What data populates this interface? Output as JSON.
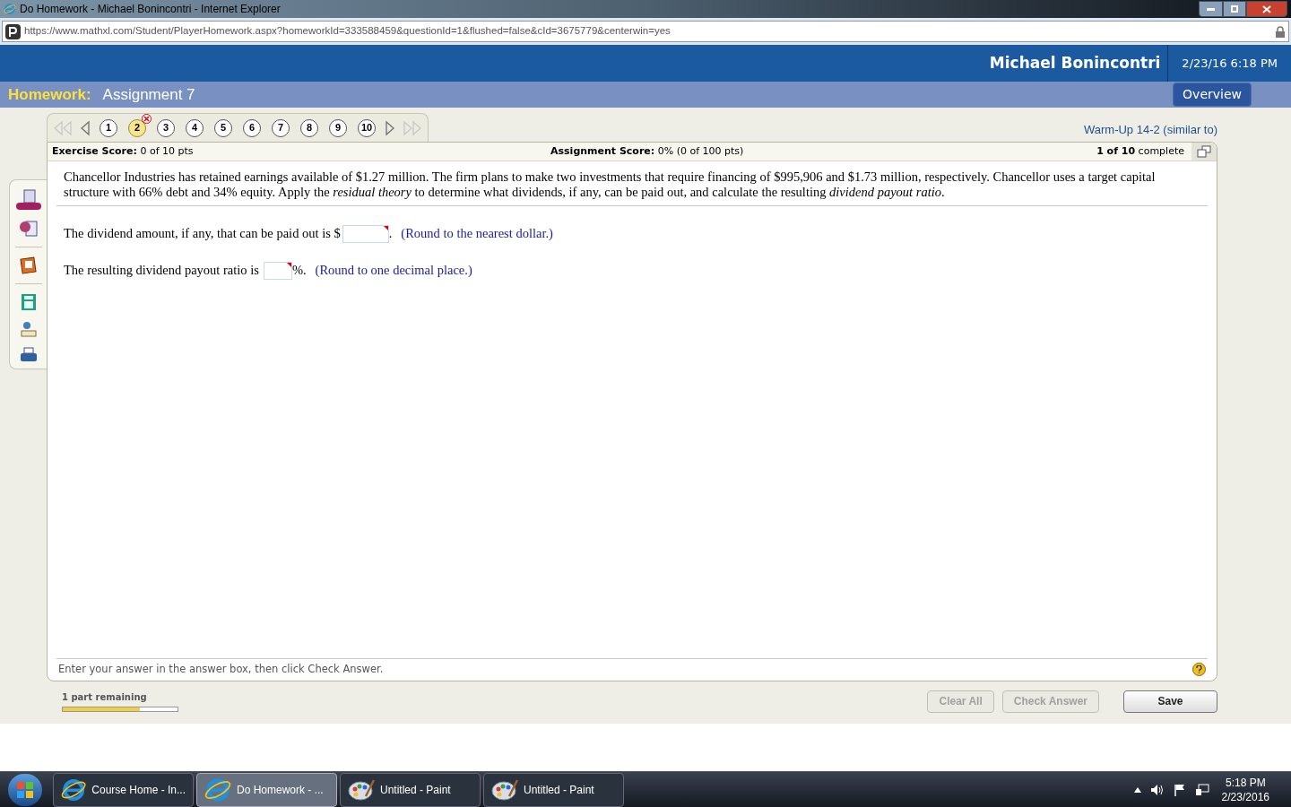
{
  "window": {
    "title": "Do Homework - Michael Bonincontri - Internet Explorer"
  },
  "address_bar": {
    "url": "https://www.mathxl.com/Student/PlayerHomework.aspx?homeworkId=333588459&questionId=1&flushed=false&cId=3675779&centerwin=yes"
  },
  "header": {
    "user": "Michael Bonincontri",
    "datetime": "2/23/16 6:18 PM"
  },
  "subheader": {
    "label": "Homework:",
    "assignment": "Assignment 7",
    "button": "Overview"
  },
  "question_nav": [
    {
      "label": "1",
      "selected": false,
      "incorrect": false
    },
    {
      "label": "2",
      "selected": true,
      "incorrect": true
    },
    {
      "label": "3",
      "selected": false,
      "incorrect": false
    },
    {
      "label": "4",
      "selected": false,
      "incorrect": false
    },
    {
      "label": "5",
      "selected": false,
      "incorrect": false
    },
    {
      "label": "6",
      "selected": false,
      "incorrect": false
    },
    {
      "label": "7",
      "selected": false,
      "incorrect": false
    },
    {
      "label": "8",
      "selected": false,
      "incorrect": false
    },
    {
      "label": "9",
      "selected": false,
      "incorrect": false
    },
    {
      "label": "10",
      "selected": false,
      "incorrect": false
    }
  ],
  "exercise_title": "Warm-Up 14-2 (similar to)",
  "scores": {
    "exercise_label": "Exercise Score:",
    "exercise_value": "0 of 10 pts",
    "assignment_label": "Assignment Score:",
    "assignment_value": "0% (0 of 100 pts)",
    "complete_count": "1 of 10",
    "complete_label": "complete"
  },
  "question": "Chancellor Industries has retained earnings available of $1.27 million.  The firm plans to make two investments that require financing of $995,906 and $1.73 million, respectively.  Chancellor uses a target capital structure with 66% debt and 34% equity.  Apply the *residual theory* to determine what dividends, if any, can be paid out, and calculate the resulting *dividend payout ratio*.",
  "answers": [
    {
      "before": "The dividend amount, if any, that can be paid out is $",
      "after": ".",
      "hint": "(Round to the nearest dollar.)",
      "wide": true
    },
    {
      "before": "The resulting dividend payout ratio is",
      "after": "%.",
      "hint": "(Round to one decimal place.)",
      "wide": false
    }
  ],
  "instruction": "Enter your answer in the answer box, then click Check Answer.",
  "progress": {
    "label": "1 part remaining",
    "level": 0.67
  },
  "buttons": [
    {
      "label": "Clear All",
      "disabled": true
    },
    {
      "label": "Check Answer",
      "disabled": true
    },
    {
      "label": "Save",
      "disabled": false
    }
  ],
  "taskbar": {
    "items": [
      {
        "label": "Course Home - In...",
        "kind": "ie",
        "selected": false
      },
      {
        "label": "Do Homework - ...",
        "kind": "ie",
        "selected": true
      },
      {
        "label": "Untitled - Paint",
        "kind": "paint",
        "selected": false
      },
      {
        "label": "Untitled - Paint",
        "kind": "paint",
        "selected": false
      }
    ],
    "time": "5:18 PM",
    "date": "2/23/2016"
  }
}
